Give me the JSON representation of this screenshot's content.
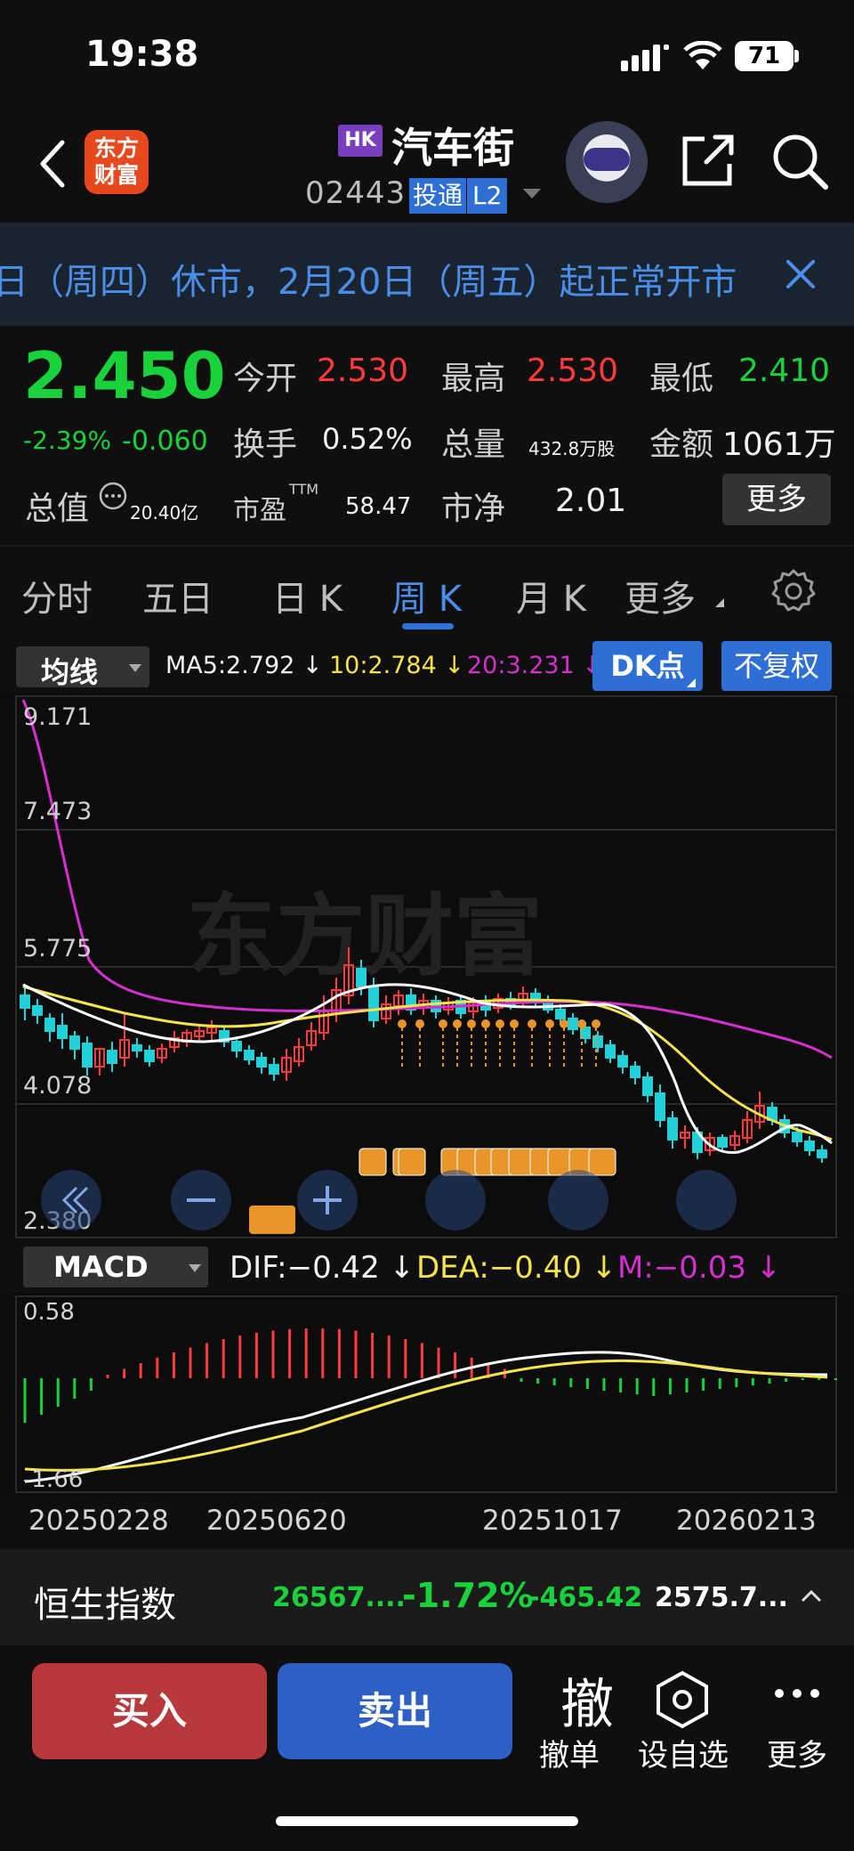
{
  "status_bar": {
    "time": "19:38",
    "battery": "71"
  },
  "header": {
    "logo_text": "东方财富",
    "market": "HK",
    "name": "汽车街",
    "code": "02443",
    "tag_tt": "投通",
    "tag_l2": "L2"
  },
  "banner": {
    "text": "日（周四）休市，2月20日（周五）起正常开市"
  },
  "quote": {
    "price": "2.450",
    "change_pct": "-2.39%",
    "change_amt": "-0.060",
    "open_label": "今开",
    "open": "2.530",
    "high_label": "最高",
    "high": "2.530",
    "low_label": "最低",
    "low": "2.410",
    "turnover_label": "换手",
    "turnover": "0.52%",
    "volume_label": "总量",
    "volume": "432.8万股",
    "amount_label": "金额",
    "amount": "1061万",
    "mktcap_label": "总值",
    "mktcap": "20.40亿",
    "pe_label": "市盈",
    "pe_sup": "TTM",
    "pe": "58.47",
    "pb_label": "市净",
    "pb": "2.01",
    "more": "更多"
  },
  "tabs": [
    "分时",
    "五日",
    "日 K",
    "周 K",
    "月 K",
    "更多"
  ],
  "active_tab": "周 K",
  "ma_bar": {
    "select": "均线",
    "ma5": "MA5:2.792 ↓",
    "ma10": "10:2.784 ↓",
    "ma20": "20:3.231 ↓",
    "dk": "DK点",
    "adjust": "不复权"
  },
  "kline": {
    "y_labels": [
      "9.171",
      "7.473",
      "5.775",
      "4.078",
      "2.380"
    ],
    "watermark": "东方财富",
    "colors": {
      "up": "#ff3b3b",
      "down": "#22d0d8",
      "ma5": "#ffffff",
      "ma10": "#f4e34a",
      "ma20": "#d62fd0"
    }
  },
  "macd": {
    "select": "MACD",
    "dif": "DIF:−0.42 ↓",
    "dea": "DEA:−0.40 ↓",
    "m": "M:−0.03 ↓",
    "y_top": "0.58",
    "y_bottom": "-1.66"
  },
  "dates": [
    "20250228",
    "20250620",
    "20251017",
    "20260213"
  ],
  "index_bar": {
    "name": "恒生指数",
    "value": "26567....",
    "pct": "-1.72%",
    "chg": "-465.42",
    "vol": "2575.7..."
  },
  "trade_bar": {
    "buy": "买入",
    "sell": "卖出",
    "cancel_glyph": "撤",
    "cancel": "撤单",
    "watch": "设自选",
    "more": "更多"
  }
}
